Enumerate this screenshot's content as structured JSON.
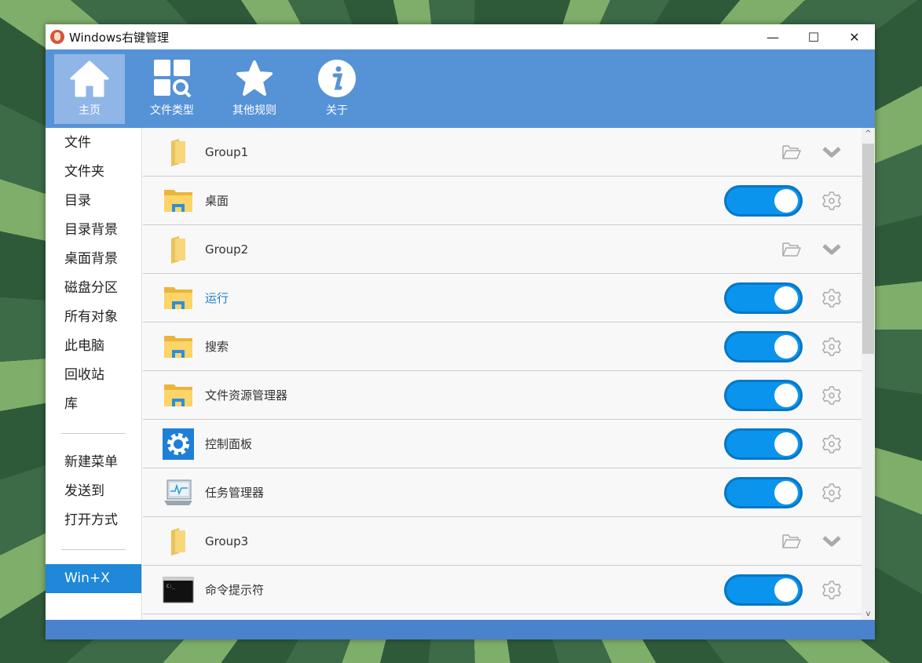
{
  "window": {
    "title": "Windows右键管理",
    "controls": {
      "minimize": "—",
      "maximize": "☐",
      "close": "✕"
    }
  },
  "toolbar": [
    {
      "label": "主页",
      "icon": "home-icon"
    },
    {
      "label": "文件类型",
      "icon": "grid-search-icon"
    },
    {
      "label": "其他规则",
      "icon": "star-icon"
    },
    {
      "label": "关于",
      "icon": "info-icon"
    }
  ],
  "sidebar": {
    "group1": [
      "文件",
      "文件夹",
      "目录",
      "目录背景",
      "桌面背景",
      "磁盘分区",
      "所有对象",
      "此电脑",
      "回收站",
      "库"
    ],
    "group2": [
      "新建菜单",
      "发送到",
      "打开方式"
    ],
    "group3": [
      "Win+X"
    ],
    "active": "Win+X"
  },
  "rows": [
    {
      "type": "group",
      "label": "Group1"
    },
    {
      "type": "item",
      "label": "桌面",
      "icon": "explorer-folder-icon",
      "enabled": true
    },
    {
      "type": "group",
      "label": "Group2"
    },
    {
      "type": "item",
      "label": "运行",
      "icon": "explorer-folder-icon",
      "enabled": true,
      "highlight": true
    },
    {
      "type": "item",
      "label": "搜索",
      "icon": "explorer-folder-icon",
      "enabled": true
    },
    {
      "type": "item",
      "label": "文件资源管理器",
      "icon": "explorer-folder-icon",
      "enabled": true
    },
    {
      "type": "item",
      "label": "控制面板",
      "icon": "control-panel-icon",
      "enabled": true
    },
    {
      "type": "item",
      "label": "任务管理器",
      "icon": "task-manager-icon",
      "enabled": true
    },
    {
      "type": "group",
      "label": "Group3"
    },
    {
      "type": "item",
      "label": "命令提示符",
      "icon": "cmd-icon",
      "enabled": true
    }
  ],
  "colors": {
    "accent": "#5692d6",
    "toggle": "#0a94ee",
    "active": "#1f88d8"
  }
}
